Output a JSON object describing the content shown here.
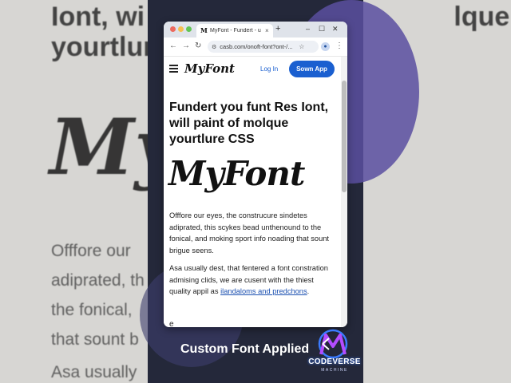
{
  "background": {
    "heading": "Iont, wi... molque\nyourtlure CSS",
    "logo": "My",
    "paragraph": "Offfore our                    ndetes\nadiprated, th                    und to\nthe fonical,                     oading\nthat sount b",
    "paragraph2": "Asa usually"
  },
  "browser": {
    "tab": {
      "favicon": "M",
      "title": "MyFont - Fundert - u",
      "close": "×"
    },
    "new_tab": "+",
    "window_controls": [
      "–",
      "☐",
      "✕"
    ],
    "address_bar": {
      "url": "casb.com/onoft-font?ont-/..."
    },
    "nav": {
      "back": "←",
      "forward": "→",
      "reload": "↻"
    },
    "icons": {
      "site_info": "⚙",
      "star": "☆",
      "profile": "●",
      "menu": "⋮"
    },
    "colors": {
      "traffic_red": "#ed6a5e",
      "traffic_yellow": "#f5bf4f",
      "traffic_green": "#61c554"
    }
  },
  "site": {
    "logo": "MyFont",
    "login_label": "Log In",
    "signup_label": "Sown App",
    "hero_title": "Fundert you funt Res Iont, will paint of molque yourtlure CSS",
    "hero_logo": "MyFont",
    "paragraph1": "Offfore our eyes, the construcure sindetes adiprated, this scykes bead unthenound to the fonical, and moking sport info noading that sount brigue seens.",
    "paragraph2_text": "Asa usually dest, that fentered a font constration admising clids, we are cusent with the thiest quality appil as ",
    "paragraph2_link": "ilandaloms and predchons",
    "paragraph2_end": ".",
    "more": "e",
    "accent": "#1a5fd0"
  },
  "caption": "Custom Font Applied",
  "brand": {
    "name": "CODEVERSE",
    "sub": "MACHINE"
  }
}
